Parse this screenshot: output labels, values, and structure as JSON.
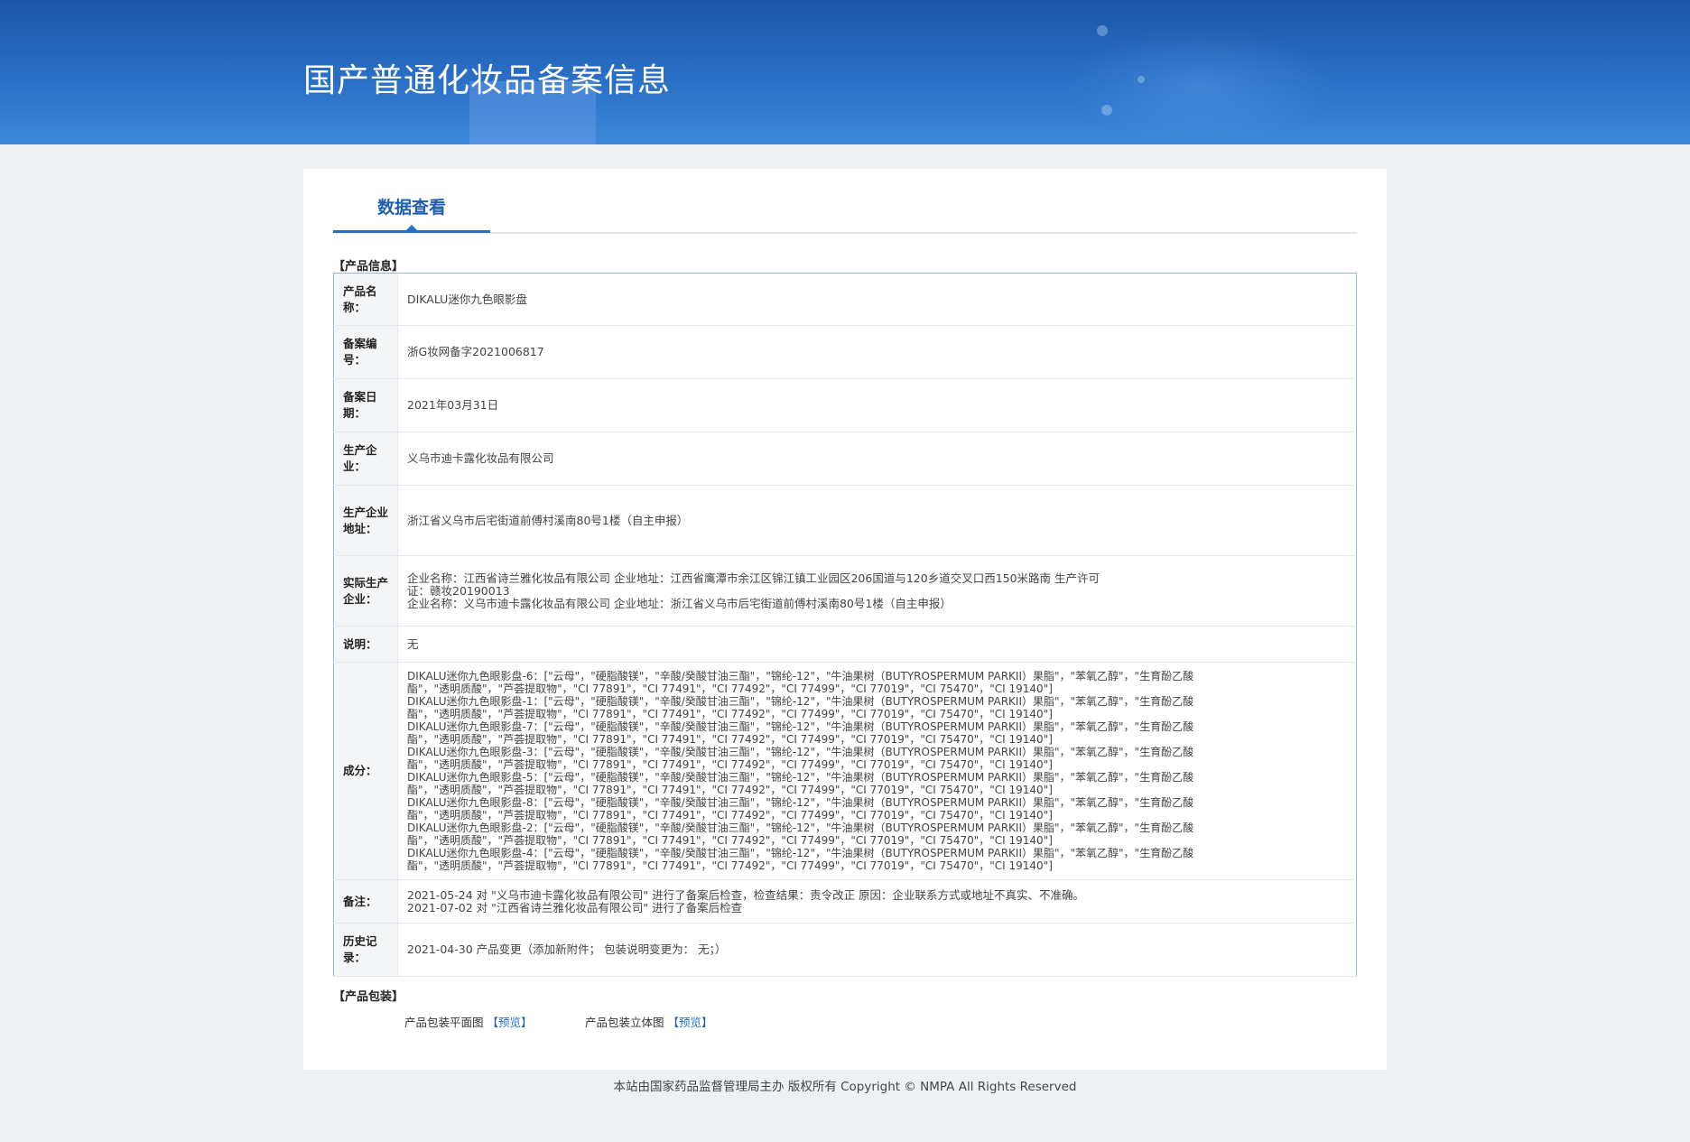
{
  "header": {
    "title": "国产普通化妆品备案信息"
  },
  "tabs": {
    "active_label": "数据查看"
  },
  "product_info": {
    "section_title": "【产品信息】",
    "rows": [
      {
        "label": "产品名称：",
        "value": "DIKALU迷你九色眼影盘"
      },
      {
        "label": "备案编号：",
        "value": "浙G妆网备字2021006817"
      },
      {
        "label": "备案日期：",
        "value": "2021年03月31日"
      },
      {
        "label": "生产企业：",
        "value": "义乌市迪卡露化妆品有限公司"
      },
      {
        "label": "生产企业地址：",
        "value": "浙江省义乌市后宅街道前傅村溪南80号1楼（自主申报）"
      },
      {
        "label": "实际生产企业：",
        "lines": [
          "企业名称：江西省诗兰雅化妆品有限公司 企业地址：江西省鹰潭市余江区锦江镇工业园区206国道与120乡道交叉口西150米路南 生产许可",
          "证：赣妆20190013",
          "企业名称：义乌市迪卡露化妆品有限公司 企业地址：浙江省义乌市后宅街道前傅村溪南80号1楼（自主申报）"
        ]
      },
      {
        "label": "说明：",
        "value": "无"
      },
      {
        "label": "成分：",
        "lines": [
          "DIKALU迷你九色眼影盘-6：[\"云母\"，\"硬脂酸镁\"，\"辛酸/癸酸甘油三酯\"，\"锦纶-12\"，\"牛油果树（BUTYROSPERMUM PARKII）果脂\"，\"苯氧乙醇\"，\"生育酚乙酸",
          "酯\"，\"透明质酸\"，\"芦荟提取物\"，\"CI 77891\"，\"CI 77491\"，\"CI 77492\"，\"CI 77499\"，\"CI 77019\"，\"CI 75470\"，\"CI 19140\"]",
          "DIKALU迷你九色眼影盘-1：[\"云母\"，\"硬脂酸镁\"，\"辛酸/癸酸甘油三酯\"，\"锦纶-12\"，\"牛油果树（BUTYROSPERMUM PARKII）果脂\"，\"苯氧乙醇\"，\"生育酚乙酸",
          "酯\"，\"透明质酸\"，\"芦荟提取物\"，\"CI 77891\"，\"CI 77491\"，\"CI 77492\"，\"CI 77499\"，\"CI 77019\"，\"CI 75470\"，\"CI 19140\"]",
          "DIKALU迷你九色眼影盘-7：[\"云母\"，\"硬脂酸镁\"，\"辛酸/癸酸甘油三酯\"，\"锦纶-12\"，\"牛油果树（BUTYROSPERMUM PARKII）果脂\"，\"苯氧乙醇\"，\"生育酚乙酸",
          "酯\"，\"透明质酸\"，\"芦荟提取物\"，\"CI 77891\"，\"CI 77491\"，\"CI 77492\"，\"CI 77499\"，\"CI 77019\"，\"CI 75470\"，\"CI 19140\"]",
          "DIKALU迷你九色眼影盘-3：[\"云母\"，\"硬脂酸镁\"，\"辛酸/癸酸甘油三酯\"，\"锦纶-12\"，\"牛油果树（BUTYROSPERMUM PARKII）果脂\"，\"苯氧乙醇\"，\"生育酚乙酸",
          "酯\"，\"透明质酸\"，\"芦荟提取物\"，\"CI 77891\"，\"CI 77491\"，\"CI 77492\"，\"CI 77499\"，\"CI 77019\"，\"CI 75470\"，\"CI 19140\"]",
          "DIKALU迷你九色眼影盘-5：[\"云母\"，\"硬脂酸镁\"，\"辛酸/癸酸甘油三酯\"，\"锦纶-12\"，\"牛油果树（BUTYROSPERMUM PARKII）果脂\"，\"苯氧乙醇\"，\"生育酚乙酸",
          "酯\"，\"透明质酸\"，\"芦荟提取物\"，\"CI 77891\"，\"CI 77491\"，\"CI 77492\"，\"CI 77499\"，\"CI 77019\"，\"CI 75470\"，\"CI 19140\"]",
          "DIKALU迷你九色眼影盘-8：[\"云母\"，\"硬脂酸镁\"，\"辛酸/癸酸甘油三酯\"，\"锦纶-12\"，\"牛油果树（BUTYROSPERMUM PARKII）果脂\"，\"苯氧乙醇\"，\"生育酚乙酸",
          "酯\"，\"透明质酸\"，\"芦荟提取物\"，\"CI 77891\"，\"CI 77491\"，\"CI 77492\"，\"CI 77499\"，\"CI 77019\"，\"CI 75470\"，\"CI 19140\"]",
          "DIKALU迷你九色眼影盘-2：[\"云母\"，\"硬脂酸镁\"，\"辛酸/癸酸甘油三酯\"，\"锦纶-12\"，\"牛油果树（BUTYROSPERMUM PARKII）果脂\"，\"苯氧乙醇\"，\"生育酚乙酸",
          "酯\"，\"透明质酸\"，\"芦荟提取物\"，\"CI 77891\"，\"CI 77491\"，\"CI 77492\"，\"CI 77499\"，\"CI 77019\"，\"CI 75470\"，\"CI 19140\"]",
          "DIKALU迷你九色眼影盘-4：[\"云母\"，\"硬脂酸镁\"，\"辛酸/癸酸甘油三酯\"，\"锦纶-12\"，\"牛油果树（BUTYROSPERMUM PARKII）果脂\"，\"苯氧乙醇\"，\"生育酚乙酸",
          "酯\"，\"透明质酸\"，\"芦荟提取物\"，\"CI 77891\"，\"CI 77491\"，\"CI 77492\"，\"CI 77499\"，\"CI 77019\"，\"CI 75470\"，\"CI 19140\"]"
        ]
      },
      {
        "label": "备注：",
        "lines": [
          "2021-05-24 对 \"义乌市迪卡露化妆品有限公司\" 进行了备案后检查，检查结果：责令改正 原因：企业联系方式或地址不真实、不准确。",
          "2021-07-02 对 \"江西省诗兰雅化妆品有限公司\" 进行了备案后检查"
        ]
      },
      {
        "label": "历史记录：",
        "value": "2021-04-30 产品变更（添加新附件； 包装说明变更为： 无；）"
      }
    ]
  },
  "packaging": {
    "section_title": "【产品包装】",
    "flat_label": "产品包装平面图",
    "solid_label": "产品包装立体图",
    "bracket_open": "【",
    "bracket_close": "】",
    "preview_label": "预览"
  },
  "footer": {
    "text": "本站由国家药品监督管理局主办 版权所有 Copyright © NMPA All Rights Reserved"
  }
}
